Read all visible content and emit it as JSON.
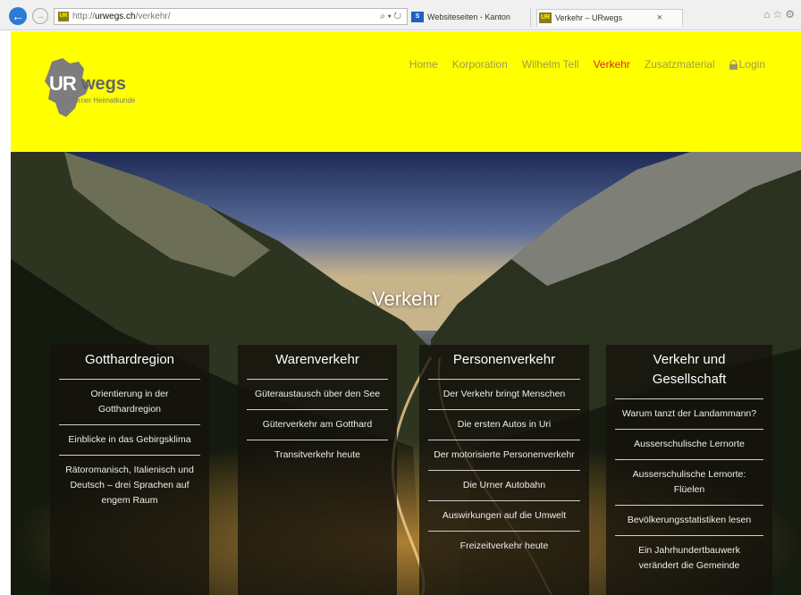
{
  "browser": {
    "url_prefix": "http://",
    "url_host": "urwegs.ch",
    "url_path": "/verkehr/",
    "url_tools": "⌕ ▾ ↻",
    "tabs": [
      {
        "label": "Websiteseiten - Kanton"
      },
      {
        "label": "Verkehr – URwegs",
        "close": "×"
      }
    ]
  },
  "header": {
    "logo_ur": "UR",
    "logo_wegs": "wegs",
    "logo_subtitle": "Urner Heimatkunde",
    "nav": [
      "Home",
      "Korporation",
      "Wilhelm Tell",
      "Verkehr",
      "Zusatzmaterial"
    ],
    "login": "Login",
    "accent_color": "#ffff00",
    "active_color": "#d03020"
  },
  "hero": {
    "title": "Verkehr"
  },
  "columns": [
    {
      "heading": "Gotthardregion",
      "items": [
        "Orientierung in der Gotthardregion",
        "Einblicke in das Gebirgsklima",
        "Rätoromanisch, Italienisch und Deutsch – drei Sprachen auf engem Raum"
      ]
    },
    {
      "heading": "Warenverkehr",
      "items": [
        "Güteraustausch über den See",
        "Güterverkehr am Gotthard",
        "Transitverkehr heute"
      ]
    },
    {
      "heading": "Personenverkehr",
      "items": [
        "Der Verkehr bringt Menschen",
        "Die ersten Autos in Uri",
        "Der motorisierte Personenverkehr",
        "Die Urner Autobahn",
        "Auswirkungen auf die Umwelt",
        "Freizeitverkehr heute"
      ]
    },
    {
      "heading": "Verkehr und Gesellschaft",
      "items": [
        "Warum tanzt der Landammann?",
        "Ausserschulische Lernorte",
        "Ausserschulische Lernorte: Flüelen",
        "Bevölkerungsstatistiken lesen",
        "Ein Jahrhundertbauwerk verändert die Gemeinde"
      ]
    }
  ]
}
